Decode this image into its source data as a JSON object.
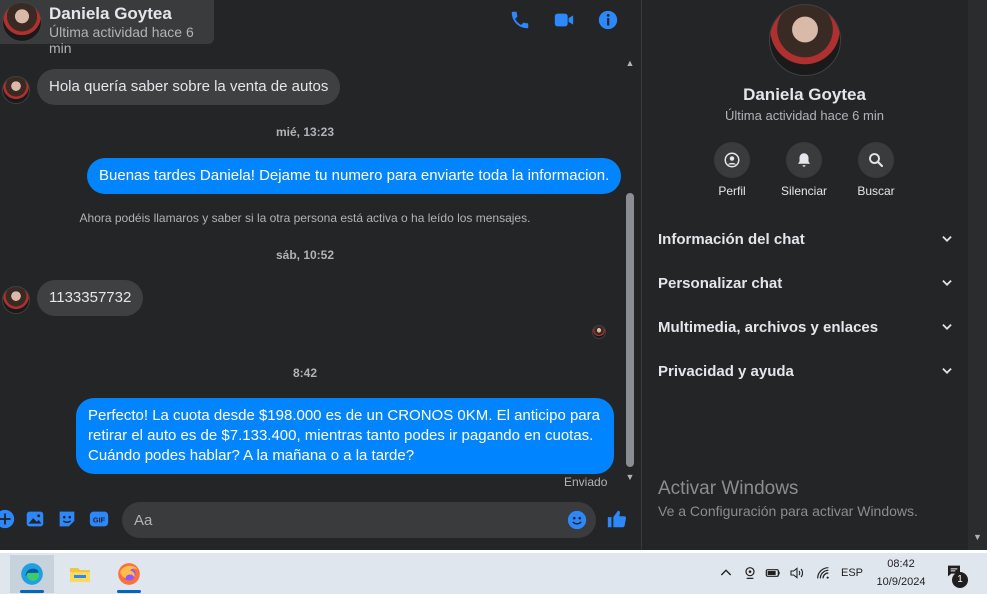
{
  "header": {
    "name": "Daniela Goytea",
    "status": "Última actividad hace 6 min",
    "icons": [
      "phone-icon",
      "video-icon",
      "info-icon"
    ]
  },
  "messages": [
    {
      "type": "in",
      "text": "Hola quería saber sobre la venta de autos"
    },
    {
      "type": "timestamp",
      "text": "mié, 13:23"
    },
    {
      "type": "out",
      "text": "Buenas tardes Daniela! Dejame tu numero para enviarte toda la informacion."
    },
    {
      "type": "notice",
      "text": "Ahora podéis llamaros y saber si la otra persona está activa o ha leído los mensajes."
    },
    {
      "type": "timestamp",
      "text": "sáb, 10:52"
    },
    {
      "type": "in",
      "text": "1133357732"
    },
    {
      "type": "timestamp",
      "text": "8:42"
    },
    {
      "type": "out",
      "text": "Perfecto! La cuota desde $198.000 es de un CRONOS 0KM. El anticipo para retirar el auto es de $7.133.400, mientras tanto podes ir pagando en cuotas. Cuándo podes hablar? A la mañana o a la tarde?"
    }
  ],
  "sent_label": "Enviado",
  "composer": {
    "placeholder": "Aa",
    "icons": [
      "plus-icon",
      "image-icon",
      "sticker-icon",
      "gif-icon",
      "emoji-icon",
      "like-icon"
    ]
  },
  "info": {
    "name": "Daniela Goytea",
    "status": "Última actividad hace 6 min",
    "actions": [
      {
        "label": "Perfil",
        "icon": "profile-icon"
      },
      {
        "label": "Silenciar",
        "icon": "bell-icon"
      },
      {
        "label": "Buscar",
        "icon": "search-icon"
      }
    ],
    "sections": [
      "Información del chat",
      "Personalizar chat",
      "Multimedia, archivos y enlaces",
      "Privacidad y ayuda"
    ],
    "watermark_title": "Activar Windows",
    "watermark_sub": "Ve a Configuración para activar Windows."
  },
  "taskbar": {
    "apps": [
      "edge-icon",
      "file-explorer-icon",
      "firefox-icon"
    ],
    "language": "ESP",
    "time": "08:42",
    "date": "10/9/2024",
    "notification_count": "1"
  },
  "colors": {
    "background": "#242526",
    "bubble_out": "#0084ff",
    "bubble_in": "#3e4042",
    "accent": "#2d88ff"
  }
}
